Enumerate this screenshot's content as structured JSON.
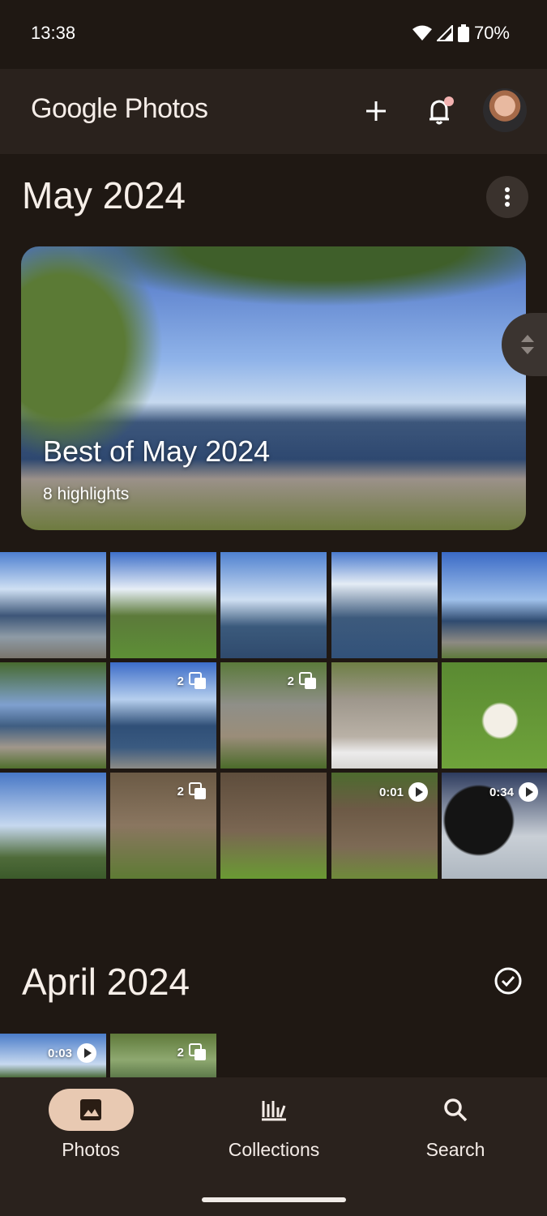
{
  "status_bar": {
    "time": "13:38",
    "battery": "70%"
  },
  "app_bar": {
    "logo_google": "Google",
    "logo_photos": "Photos"
  },
  "sections": [
    {
      "title": "May 2024"
    },
    {
      "title": "April 2024"
    }
  ],
  "highlight": {
    "title": "Best of May 2024",
    "subtitle": "8 highlights"
  },
  "grid": [
    {
      "badge": ""
    },
    {
      "badge": ""
    },
    {
      "badge": ""
    },
    {
      "badge": ""
    },
    {
      "badge": ""
    },
    {
      "badge": ""
    },
    {
      "badge": "2",
      "type": "stack"
    },
    {
      "badge": "2",
      "type": "stack"
    },
    {
      "badge": ""
    },
    {
      "badge": ""
    },
    {
      "badge": ""
    },
    {
      "badge": "2",
      "type": "stack"
    },
    {
      "badge": ""
    },
    {
      "badge": "0:01",
      "type": "video"
    },
    {
      "badge": "0:34",
      "type": "video"
    }
  ],
  "april_grid": [
    {
      "badge": "0:03",
      "type": "video"
    },
    {
      "badge": "2",
      "type": "stack"
    }
  ],
  "nav": {
    "photos": "Photos",
    "collections": "Collections",
    "search": "Search"
  },
  "colors": {
    "background": "#1f1813",
    "surface": "#2a221d",
    "accent_pill": "#e8c9b2"
  },
  "icons": [
    "add-icon",
    "bell-icon",
    "more-vert-icon",
    "check-circle-icon",
    "photo-icon",
    "library-icon",
    "search-icon",
    "stack-icon",
    "play-icon"
  ]
}
